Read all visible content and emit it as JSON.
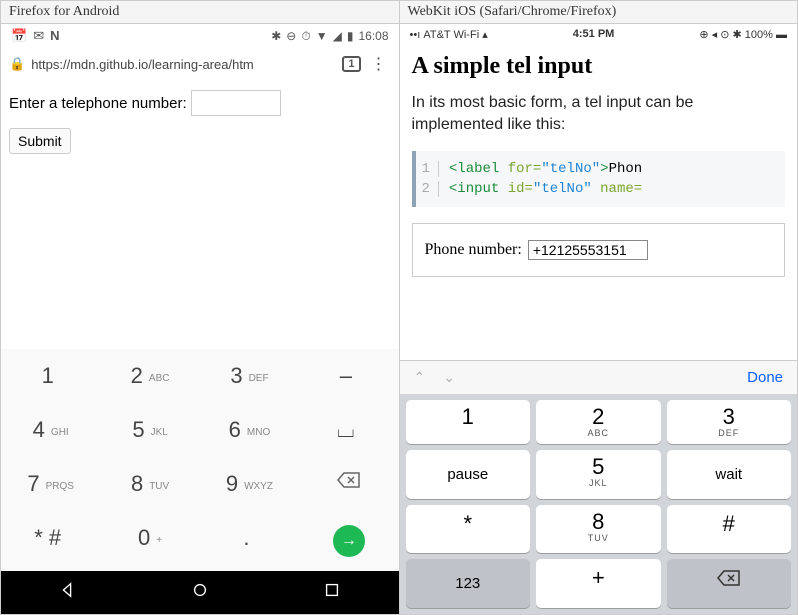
{
  "android": {
    "title": "Firefox for Android",
    "status": {
      "left_icons": [
        "calendar-icon",
        "mail-icon",
        "n-icon"
      ],
      "left_glyphs": [
        "📅",
        "✉",
        "N"
      ],
      "right_glyphs": [
        "*",
        "⊖",
        "⏱",
        "▼",
        "▮",
        "🔋"
      ],
      "time": "16:08"
    },
    "urlbar": {
      "url": "https://mdn.github.io/learning-area/htm",
      "tab_count": "1"
    },
    "form": {
      "label": "Enter a telephone number:",
      "value": "",
      "submit": "Submit"
    },
    "keypad": [
      [
        {
          "d": "1",
          "s": ""
        },
        {
          "d": "2",
          "s": "ABC"
        },
        {
          "d": "3",
          "s": "DEF"
        },
        {
          "d": "–",
          "s": ""
        }
      ],
      [
        {
          "d": "4",
          "s": "GHI"
        },
        {
          "d": "5",
          "s": "JKL"
        },
        {
          "d": "6",
          "s": "MNO"
        },
        {
          "d": "⌴",
          "s": ""
        }
      ],
      [
        {
          "d": "7",
          "s": "PRQS"
        },
        {
          "d": "8",
          "s": "TUV"
        },
        {
          "d": "9",
          "s": "WXYZ"
        },
        {
          "d": "⌫",
          "s": ""
        }
      ],
      [
        {
          "d": "* #",
          "s": ""
        },
        {
          "d": "0",
          "s": "+"
        },
        {
          "d": ".",
          "s": ""
        },
        {
          "d": "→",
          "s": ""
        }
      ]
    ]
  },
  "ios": {
    "title": "WebKit iOS (Safari/Chrome/Firefox)",
    "status": {
      "carrier": "AT&T Wi-Fi",
      "time": "4:51 PM",
      "battery": "100%"
    },
    "heading": "A simple tel input",
    "paragraph": "In its most basic form, a tel input can be implemented like this:",
    "code": {
      "line1": {
        "ln": "1",
        "tag": "<label",
        "attr": " for=",
        "str": "\"telNo\"",
        "tag2": ">",
        "rest": "Phon"
      },
      "line2": {
        "ln": "2",
        "tag": "<input",
        "attr": " id=",
        "str": "\"telNo\"",
        "attr2": "  name="
      }
    },
    "form": {
      "label": "Phone number:",
      "value": "+12125553151"
    },
    "accessory": {
      "done": "Done"
    },
    "keypad": [
      [
        {
          "d": "1",
          "s": ""
        },
        {
          "d": "2",
          "s": "ABC"
        },
        {
          "d": "3",
          "s": "DEF"
        }
      ],
      [
        {
          "d": "pause",
          "s": "",
          "word": true
        },
        {
          "d": "5",
          "s": "JKL"
        },
        {
          "d": "wait",
          "s": "",
          "word": true
        }
      ],
      [
        {
          "d": "*",
          "s": "",
          "sym": true
        },
        {
          "d": "8",
          "s": "TUV"
        },
        {
          "d": "#",
          "s": "",
          "sym": true
        }
      ],
      [
        {
          "d": "123",
          "s": "",
          "gray": true,
          "word": true
        },
        {
          "d": "+",
          "s": "",
          "sym": true
        },
        {
          "d": "⌫",
          "s": "",
          "gray": true,
          "sym": true
        }
      ]
    ]
  }
}
